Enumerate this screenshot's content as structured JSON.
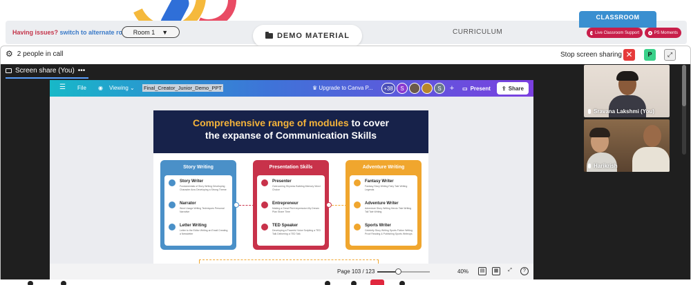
{
  "header": {
    "issues_text": "Having issues?",
    "alt_room_link": "switch to alternate room",
    "room_value": "Room 1",
    "demo_label": "DEMO MATERIAL",
    "curriculum_label": "CURRICULUM",
    "classroom_label": "CLASSROOM",
    "live_support_label": "Live Classroom Support",
    "ps_moments_label": "PS Moments"
  },
  "call": {
    "people_text": "2 people in call",
    "stop_sharing_label": "Stop screen sharing",
    "close_glyph": "✕",
    "p_badge": "P",
    "share_tab_label": "Screen share (You)",
    "more_glyph": "•••"
  },
  "canva": {
    "menu_glyph": "☰",
    "file_label": "File",
    "viewing_label": "Viewing",
    "doc_title": "Final_Creator_Junior_Demo_PPT",
    "upgrade_label": "Upgrade to Canva P...",
    "collab_count": "+38",
    "avatar_s1": "S",
    "avatar_s2": "S",
    "plus_glyph": "+",
    "present_label": "Present",
    "share_label": "Share",
    "page_indicator": "Page 103 / 123",
    "zoom_value": "40%",
    "zoom_fraction": 0.4,
    "help_glyph": "?"
  },
  "slide": {
    "title_highlight": "Comprehensive range of modules",
    "title_rest": "to cover",
    "title_line2": "the expanse of Communication Skills",
    "columns": [
      {
        "title": "Story Writing",
        "color": "#4a90c8",
        "modules": [
          {
            "name": "Story Writer",
            "sub": "Fundamentals of Story Writing Developing Character Arcs Developing a Strong Theme"
          },
          {
            "name": "Narrator",
            "sub": "Word Usage Writing Techniques Personal Narrative"
          },
          {
            "name": "Letter Writing",
            "sub": "Letter to the Editor Writing an Email Creating a Newsletter"
          }
        ]
      },
      {
        "title": "Presentation Skills",
        "color": "#c8324a",
        "modules": [
          {
            "name": "Presenter",
            "sub": "Overcoming Shyness Building Memory Word Choice"
          },
          {
            "name": "Entrepreneur",
            "sub": "Making a Great Pitch impression My Dream Plan Share Time"
          },
          {
            "name": "TED Speaker",
            "sub": "Developing a Powerful Voice Scripting a TED Talk Delivering a TED Talk"
          }
        ]
      },
      {
        "title": "Adventure Writing",
        "color": "#f0a62e",
        "modules": [
          {
            "name": "Fantasy Writer",
            "sub": "Fantasy Story Writing Fairy Tale Writing Legends"
          },
          {
            "name": "Adventure Writer",
            "sub": "Adventure Story Writing Heroic Tale Writing Tall Tale Writing"
          },
          {
            "name": "Sports Writer",
            "sub": "Celebrity Story Writing Sports Fiction Writing Proof Reading & Publishing Sports Writeups"
          }
        ]
      }
    ]
  },
  "participants": [
    {
      "name": "Sravana Lakshmi (You)"
    },
    {
      "name": "Harikrish"
    }
  ],
  "colors": {
    "accent_red": "#c81e4a",
    "classroom_blue": "#3a8fd0",
    "meet_bg": "#1f1f1f",
    "slide_navy": "#17224a"
  }
}
